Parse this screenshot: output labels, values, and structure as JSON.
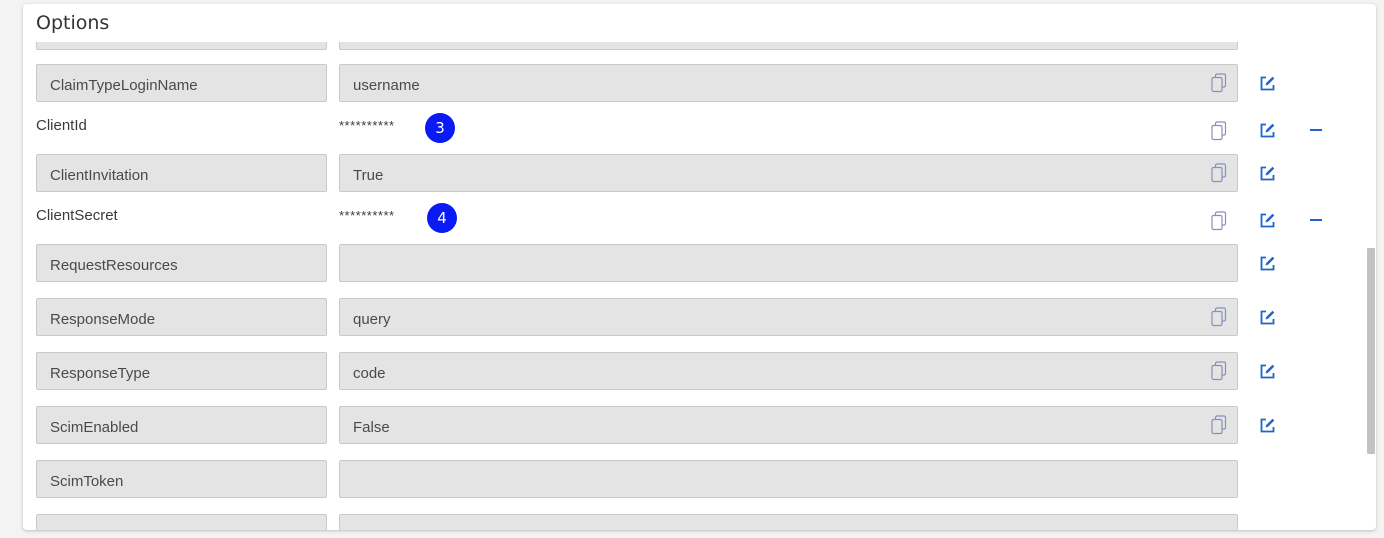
{
  "section": {
    "title": "Options"
  },
  "rows": {
    "r0": {
      "key": "",
      "value": ""
    },
    "r1": {
      "key": "ClaimTypeLoginName",
      "value": "username"
    },
    "r2": {
      "key": "ClientId",
      "value": "**********",
      "badge": "3"
    },
    "r3": {
      "key": "ClientInvitation",
      "value": "True"
    },
    "r4": {
      "key": "ClientSecret",
      "value": "**********",
      "badge": "4"
    },
    "r5": {
      "key": "RequestResources",
      "value": ""
    },
    "r6": {
      "key": "ResponseMode",
      "value": "query"
    },
    "r7": {
      "key": "ResponseType",
      "value": "code"
    },
    "r8": {
      "key": "ScimEnabled",
      "value": "False"
    },
    "r9": {
      "key": "ScimToken",
      "value": ""
    },
    "r10": {
      "key": "",
      "value": ""
    }
  },
  "colors": {
    "accent": "#1e66c9",
    "badge": "#0a1af5",
    "field_bg": "#e4e4e4"
  },
  "icons": {
    "copy": "copy-icon",
    "edit": "edit-icon",
    "remove": "minus-icon"
  }
}
